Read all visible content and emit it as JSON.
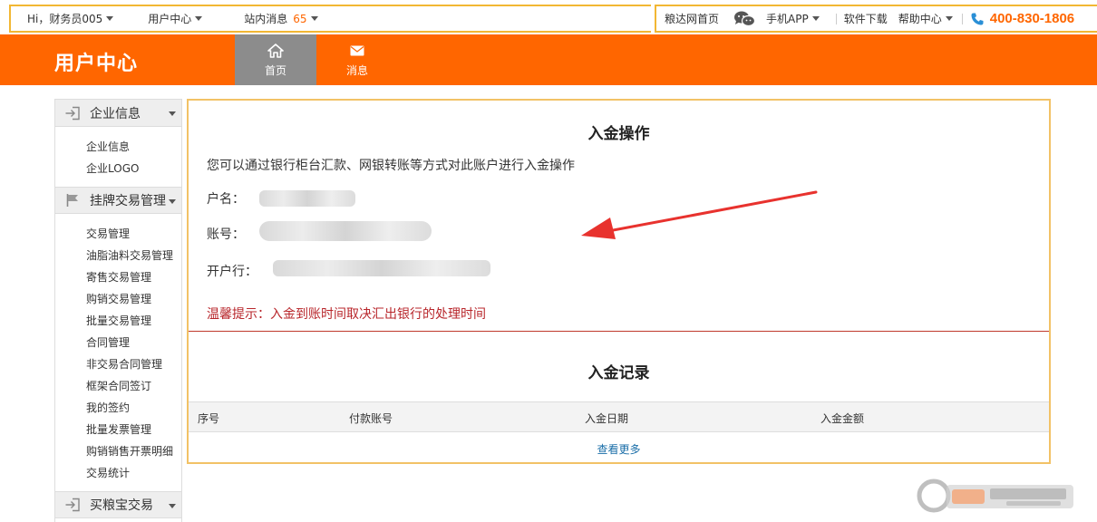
{
  "topbar": {
    "greeting": "Hi，财务员005",
    "user_center": "用户中心",
    "site_msg": "站内消息",
    "msg_count": "65",
    "home_link": "粮达网首页",
    "mobile_app": "手机APP",
    "software_download": "软件下载",
    "help_center": "帮助中心",
    "phone": "400-830-1806"
  },
  "header": {
    "brand": "用户中心",
    "tabs": [
      {
        "label": "首页",
        "icon": "home-icon"
      },
      {
        "label": "消息",
        "icon": "mail-icon"
      }
    ]
  },
  "sidebar": {
    "sections": [
      {
        "title": "企业信息",
        "icon": "login-arrow-icon",
        "items": [
          "企业信息",
          "企业LOGO"
        ]
      },
      {
        "title": "挂牌交易管理",
        "icon": "flag-icon",
        "items": [
          "交易管理",
          "油脂油料交易管理",
          "寄售交易管理",
          "购销交易管理",
          "批量交易管理",
          "合同管理",
          "非交易合同管理",
          "框架合同签订",
          "我的签约",
          "批量发票管理",
          "购销销售开票明细",
          "交易统计"
        ]
      },
      {
        "title": "买粮宝交易",
        "icon": "login-arrow-icon",
        "items": []
      }
    ]
  },
  "main": {
    "title": "入金操作",
    "desc": "您可以通过银行柜台汇款、网银转账等方式对此账户进行入金操作",
    "account_name_label": "户名：",
    "account_no_label": "账号：",
    "bank_label": "开户行：",
    "tip": "温馨提示：入金到账时间取决汇出银行的处理时间",
    "records_title": "入金记录",
    "columns": [
      "序号",
      "付款账号",
      "入金日期",
      "入金金额"
    ],
    "more": "查看更多"
  },
  "colors": {
    "brand_orange": "#ff6600",
    "frame_gold": "#f2b733",
    "tip_red": "#b8262b",
    "arrow_red": "#e8322e",
    "link_blue": "#1a6ea8"
  }
}
